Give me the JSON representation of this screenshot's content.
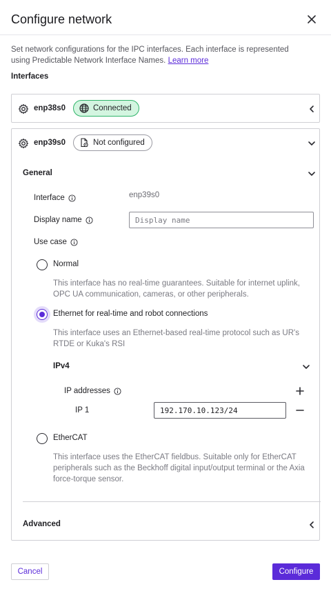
{
  "dialog": {
    "title": "Configure network",
    "description": "Set network configurations for the IPC interfaces. Each interface is represented using Predictable Network Interface Names.",
    "learn_more": "Learn more",
    "interfaces_label": "Interfaces"
  },
  "interfaces": [
    {
      "name": "enp38s0",
      "status": "Connected",
      "status_color": "#2fb469",
      "expanded": false
    },
    {
      "name": "enp39s0",
      "status": "Not configured",
      "expanded": true
    }
  ],
  "general": {
    "heading": "General",
    "interface_label": "Interface",
    "interface_value": "enp39s0",
    "display_name_label": "Display name",
    "display_name_placeholder": "Display name",
    "display_name_value": "",
    "use_case_label": "Use case",
    "options": [
      {
        "label": "Normal",
        "help": "This interface has no real-time guarantees. Suitable for internet uplink, OPC UA communication, cameras, or other peripherals.",
        "selected": false
      },
      {
        "label": "Ethernet for real-time and robot connections",
        "help": "This interface uses an Ethernet-based real-time protocol such as UR's RTDE or Kuka's RSI",
        "selected": true
      },
      {
        "label": "EtherCAT",
        "help": "This interface uses the EtherCAT fieldbus. Suitable only for EtherCAT peripherals such as the Beckhoff digital input/output terminal or the Axia force-torque sensor.",
        "selected": false
      }
    ],
    "ipv4": {
      "heading": "IPv4",
      "ip_addresses_label": "IP addresses",
      "ips": [
        {
          "label": "IP 1",
          "value": "192.170.10.123/24"
        }
      ]
    }
  },
  "advanced": {
    "heading": "Advanced"
  },
  "footer": {
    "cancel": "Cancel",
    "configure": "Configure"
  },
  "colors": {
    "accent": "#5b2bd9",
    "success": "#2fb469",
    "border": "#cfcfd4"
  }
}
